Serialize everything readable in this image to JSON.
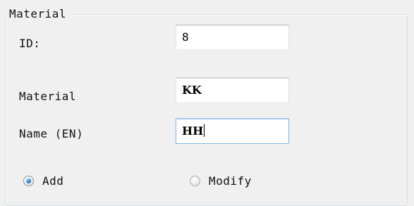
{
  "group": {
    "title": "Material"
  },
  "form": {
    "id_label": "ID:",
    "id_value": "8",
    "material_label": "Material",
    "material_value": "KK",
    "name_en_label": "Name (EN)",
    "name_en_value": "HH"
  },
  "mode": {
    "add_label": "Add",
    "modify_label": "Modify",
    "selected": "Add"
  },
  "colors": {
    "window_bg": "#f0f0f0",
    "focus_border": "#569de5",
    "radio_selected": "#2f7fc8"
  }
}
